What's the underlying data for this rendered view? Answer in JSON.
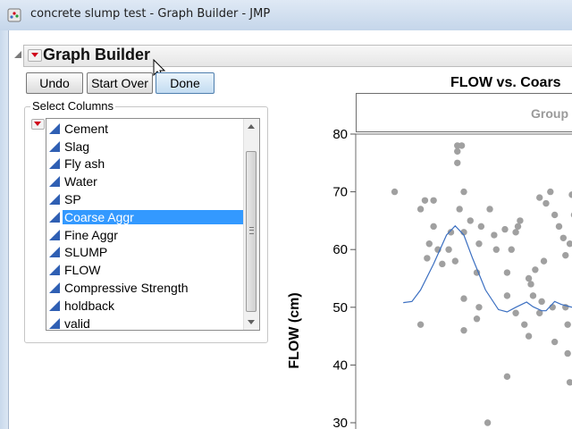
{
  "window": {
    "title": "concrete slump test - Graph Builder - JMP"
  },
  "graph_builder": {
    "title": "Graph Builder"
  },
  "toolbar": {
    "undo_label": "Undo",
    "start_over_label": "Start Over",
    "done_label": "Done"
  },
  "select_columns": {
    "label": "Select Columns",
    "items": [
      {
        "label": "Cement",
        "icon": "continuous-icon"
      },
      {
        "label": "Slag",
        "icon": "continuous-icon"
      },
      {
        "label": "Fly ash",
        "icon": "continuous-icon"
      },
      {
        "label": "Water",
        "icon": "continuous-icon"
      },
      {
        "label": "SP",
        "icon": "continuous-icon"
      },
      {
        "label": "Coarse Aggr",
        "icon": "continuous-icon",
        "selected": true
      },
      {
        "label": "Fine Aggr",
        "icon": "continuous-icon"
      },
      {
        "label": "SLUMP",
        "icon": "continuous-icon"
      },
      {
        "label": "FLOW",
        "icon": "continuous-icon"
      },
      {
        "label": "Compressive Strength",
        "icon": "continuous-icon"
      },
      {
        "label": "holdback",
        "icon": "continuous-icon"
      },
      {
        "label": "valid",
        "icon": "continuous-icon"
      }
    ]
  },
  "graph": {
    "title": "FLOW vs. Coars",
    "group_label": "Group",
    "y_axis_label": "FLOW (cm)"
  },
  "chart_data": {
    "type": "scatter",
    "title": "FLOW vs. Coars",
    "ylabel": "FLOW (cm)",
    "ylim": [
      28,
      80
    ],
    "y_ticks": [
      "80",
      "70",
      "60",
      "50",
      "40",
      "30"
    ],
    "x_ticks": [],
    "point_color": "#a0a0a0",
    "smoother_color": "#3b6fc1",
    "points": [
      [
        0.18,
        70
      ],
      [
        0.3,
        67
      ],
      [
        0.32,
        68.5
      ],
      [
        0.36,
        68.5
      ],
      [
        0.34,
        61
      ],
      [
        0.33,
        58.5
      ],
      [
        0.38,
        60
      ],
      [
        0.36,
        64
      ],
      [
        0.43,
        60
      ],
      [
        0.44,
        63
      ],
      [
        0.46,
        58
      ],
      [
        0.4,
        57.5
      ],
      [
        0.47,
        78
      ],
      [
        0.49,
        78
      ],
      [
        0.47,
        77
      ],
      [
        0.47,
        75
      ],
      [
        0.5,
        70
      ],
      [
        0.48,
        67
      ],
      [
        0.5,
        63
      ],
      [
        0.53,
        65
      ],
      [
        0.58,
        64
      ],
      [
        0.57,
        61
      ],
      [
        0.56,
        56
      ],
      [
        0.57,
        50
      ],
      [
        0.62,
        67
      ],
      [
        0.64,
        62.5
      ],
      [
        0.65,
        60
      ],
      [
        0.69,
        63.5
      ],
      [
        0.74,
        63
      ],
      [
        0.72,
        60
      ],
      [
        0.7,
        56
      ],
      [
        0.75,
        64
      ],
      [
        0.76,
        65
      ],
      [
        0.8,
        55
      ],
      [
        0.81,
        54
      ],
      [
        0.83,
        56.5
      ],
      [
        0.85,
        69
      ],
      [
        0.88,
        68
      ],
      [
        0.9,
        70
      ],
      [
        0.92,
        66
      ],
      [
        0.94,
        64
      ],
      [
        0.96,
        62
      ],
      [
        0.97,
        59
      ],
      [
        0.99,
        61
      ],
      [
        1.0,
        69.5
      ],
      [
        1.01,
        66
      ],
      [
        0.87,
        58
      ],
      [
        0.82,
        52
      ],
      [
        0.91,
        50
      ],
      [
        0.97,
        50
      ],
      [
        0.85,
        49
      ],
      [
        0.8,
        45
      ],
      [
        0.92,
        44
      ],
      [
        0.98,
        42
      ],
      [
        0.99,
        37
      ],
      [
        0.78,
        47
      ],
      [
        0.74,
        49
      ],
      [
        0.7,
        52
      ],
      [
        0.5,
        46
      ],
      [
        0.5,
        51.5
      ],
      [
        0.3,
        47
      ],
      [
        0.7,
        38
      ],
      [
        0.61,
        30
      ],
      [
        0.56,
        48
      ],
      [
        0.98,
        47
      ],
      [
        0.86,
        51
      ]
    ],
    "smoother": [
      [
        0.22,
        50.8
      ],
      [
        0.26,
        51
      ],
      [
        0.3,
        53
      ],
      [
        0.36,
        57.5
      ],
      [
        0.42,
        62.5
      ],
      [
        0.46,
        64.1
      ],
      [
        0.5,
        62.5
      ],
      [
        0.54,
        58.5
      ],
      [
        0.6,
        53
      ],
      [
        0.66,
        49.6
      ],
      [
        0.7,
        49.2
      ],
      [
        0.74,
        50
      ],
      [
        0.79,
        50.9
      ],
      [
        0.82,
        50.1
      ],
      [
        0.86,
        49.4
      ],
      [
        0.88,
        49.4
      ],
      [
        0.92,
        51
      ],
      [
        0.95,
        50.5
      ],
      [
        0.98,
        50.2
      ],
      [
        1.0,
        50
      ]
    ]
  }
}
